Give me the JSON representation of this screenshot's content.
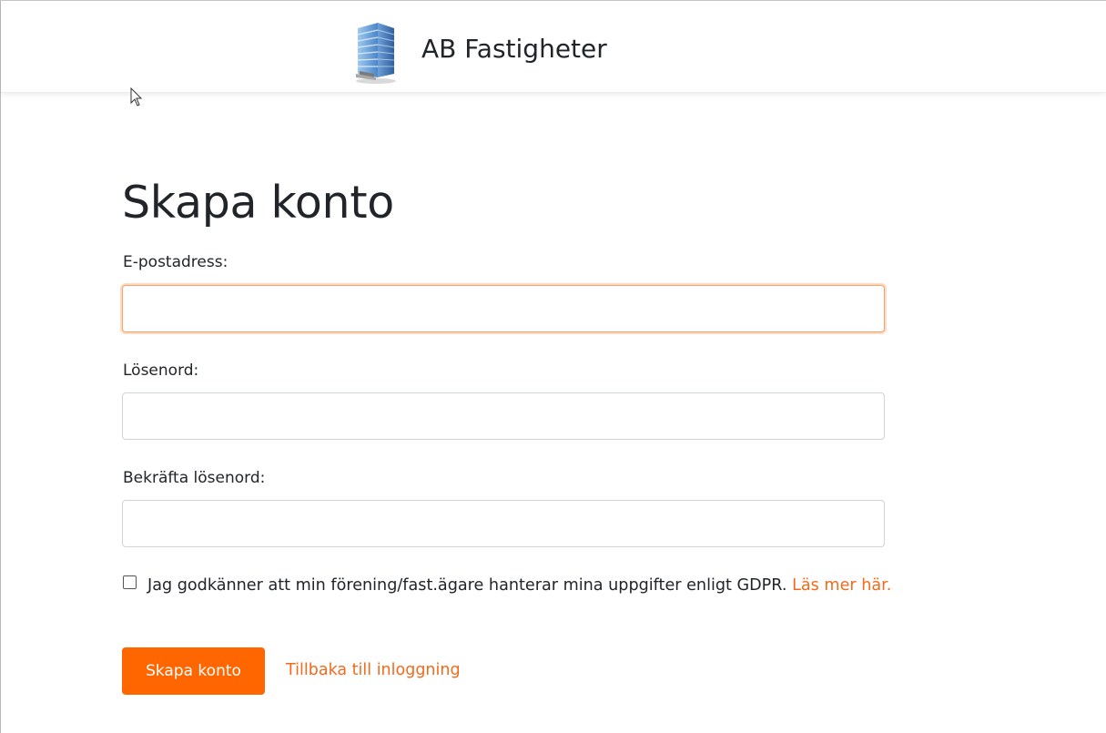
{
  "header": {
    "logo_icon": "office-building-icon",
    "brand_name": "AB Fastigheter"
  },
  "form": {
    "title": "Skapa konto",
    "email": {
      "label": "E-postadress:",
      "value": "",
      "placeholder": ""
    },
    "password": {
      "label": "Lösenord:",
      "value": "",
      "placeholder": ""
    },
    "confirm_password": {
      "label": "Bekräfta lösenord:",
      "value": "",
      "placeholder": ""
    },
    "gdpr": {
      "checked": false,
      "text": "Jag godkänner att min förening/fast.ägare hanterar mina uppgifter enligt GDPR.",
      "link_text": "Läs mer här."
    },
    "submit_label": "Skapa konto",
    "back_link": "Tillbaka till inloggning"
  },
  "colors": {
    "accent": "#ff6600",
    "link": "#f26a1b",
    "focus_border": "#f5a36c",
    "text": "#212529"
  }
}
